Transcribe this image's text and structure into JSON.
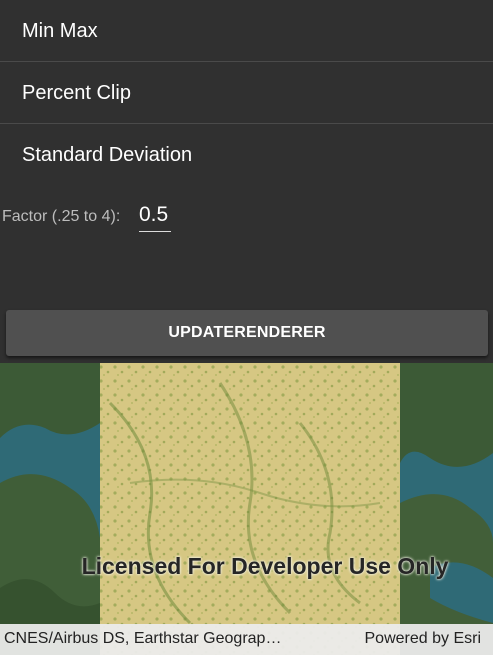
{
  "stretch_options": [
    {
      "label": "Min Max"
    },
    {
      "label": "Percent Clip"
    },
    {
      "label": "Standard Deviation"
    }
  ],
  "factor": {
    "label": "Factor (.25 to 4):",
    "value": "0.5"
  },
  "update_button": {
    "label": "UPDATERENDERER"
  },
  "map": {
    "watermark": "Licensed For Developer Use Only",
    "attribution": "CNES/Airbus DS, Earthstar Geograp…",
    "powered_by": "Powered by Esri"
  },
  "colors": {
    "panel_bg": "#303030",
    "button_bg": "#505050",
    "raster_fill": "#d6c783",
    "water": "#2f6a76",
    "land": "#3c5a36"
  }
}
